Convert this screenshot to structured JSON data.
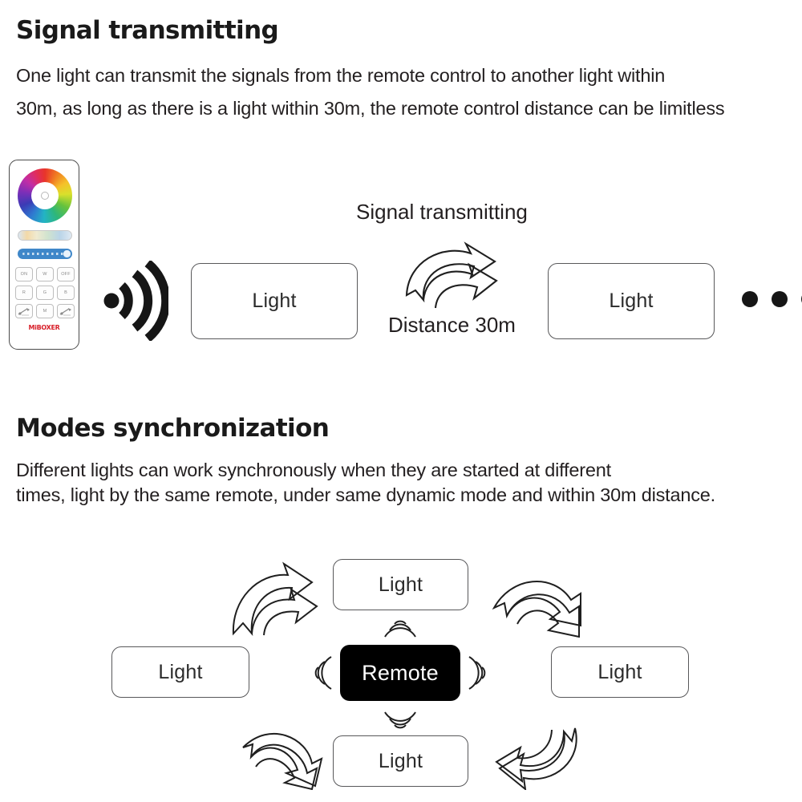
{
  "sections": [
    {
      "heading": "Signal transmitting",
      "body_lines": [
        "One light can transmit the signals from the remote control to another light within",
        "30m, as long as there is a light within 30m, the remote control distance can be limitless"
      ]
    },
    {
      "heading": "Modes synchronization",
      "body_lines": [
        "Different lights can work synchronously when they are started at different",
        "times, light by the same remote, under same dynamic mode and within 30m distance."
      ]
    }
  ],
  "remote_control": {
    "brand_logo": "MiBOXER",
    "keys": [
      {
        "label": "ON",
        "name": "on-button"
      },
      {
        "label": "W",
        "name": "white-button"
      },
      {
        "label": "OFF",
        "name": "off-button"
      },
      {
        "label": "R",
        "name": "red-button"
      },
      {
        "label": "G",
        "name": "green-button"
      },
      {
        "label": "B",
        "name": "blue-button"
      },
      {
        "label": "",
        "name": "speed-down-button",
        "icon": "speed-minus-icon"
      },
      {
        "label": "M",
        "name": "mode-button"
      },
      {
        "label": "",
        "name": "speed-up-button",
        "icon": "speed-plus-icon"
      }
    ]
  },
  "diagram_top": {
    "title_label": "Signal transmitting",
    "distance_label": "Distance 30m",
    "light_a": "Light",
    "light_b": "Light",
    "ellipsis_dot_count": 3,
    "signal_icon": "wifi-signal-icon",
    "arrow_icon": "double-curved-arrow-right-icon"
  },
  "diagram_bottom": {
    "remote_label": "Remote",
    "light_top": "Light",
    "light_left": "Light",
    "light_right": "Light",
    "light_bottom": "Light",
    "wave_icons": [
      "signal-wave-up-icon",
      "signal-wave-down-icon",
      "signal-wave-left-icon",
      "signal-wave-right-icon"
    ],
    "arrow_icons": [
      "curved-arrow-up-right-icon",
      "curved-arrow-down-right-icon",
      "curved-arrow-up-left-icon",
      "curved-arrow-down-left-icon"
    ]
  },
  "colors": {
    "text": "#231f20",
    "heading": "#1a1a1a",
    "box_border": "#58585a",
    "remote_node_bg": "#000000",
    "remote_node_text": "#ffffff",
    "brand_red": "#d8202a",
    "slider_blue": "#3f87c9",
    "background": "#ffffff"
  }
}
